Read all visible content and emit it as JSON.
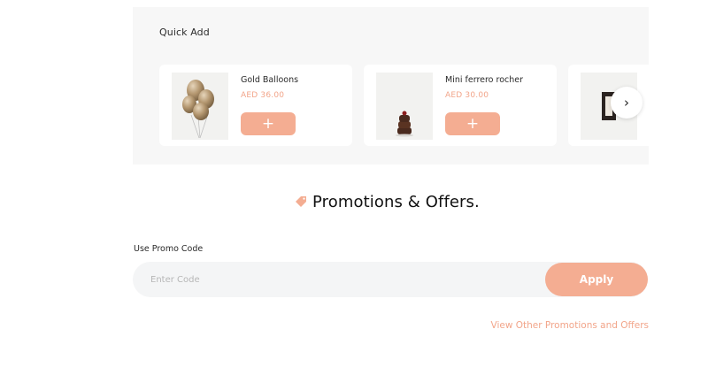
{
  "quick_add": {
    "title": "Quick Add",
    "products": [
      {
        "name": "Gold Balloons",
        "price": "AED 36.00",
        "add_label": "+",
        "image": "gold-balloons"
      },
      {
        "name": "Mini ferrero rocher",
        "price": "AED 30.00",
        "add_label": "+",
        "image": "ferrero-tower"
      },
      {
        "name": "",
        "price": "",
        "add_label": "",
        "image": "frame-partial"
      }
    ],
    "next_icon": "chevron-right-icon",
    "next_glyph": "›"
  },
  "promotions": {
    "title": "Promotions & Offers.",
    "icon": "tag-icon",
    "promo_label": "Use Promo Code",
    "input_placeholder": "Enter Code",
    "input_value": "",
    "apply_label": "Apply",
    "view_other_label": "View Other Promotions and Offers"
  },
  "colors": {
    "accent": "#f4ad92",
    "accent_text": "#f2a58a",
    "panel_bg": "#f7f7f7",
    "field_bg": "#f4f5f6"
  }
}
